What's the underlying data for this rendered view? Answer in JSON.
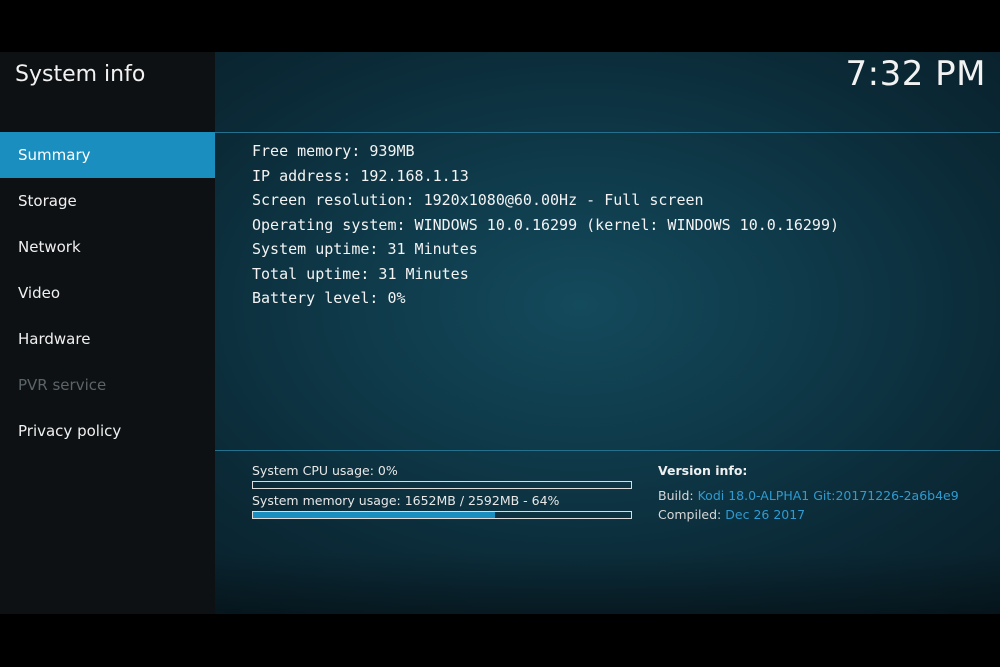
{
  "app": {
    "title": "System info",
    "clock": "7:32 PM"
  },
  "menu": {
    "items": [
      {
        "label": "Summary",
        "state": "active"
      },
      {
        "label": "Storage",
        "state": "normal"
      },
      {
        "label": "Network",
        "state": "normal"
      },
      {
        "label": "Video",
        "state": "normal"
      },
      {
        "label": "Hardware",
        "state": "normal"
      },
      {
        "label": "PVR service",
        "state": "disabled"
      },
      {
        "label": "Privacy policy",
        "state": "normal"
      }
    ]
  },
  "summary": {
    "lines": [
      "Free memory: 939MB",
      "IP address: 192.168.1.13",
      "Screen resolution: 1920x1080@60.00Hz - Full screen",
      "Operating system: WINDOWS 10.0.16299 (kernel: WINDOWS 10.0.16299)",
      "System uptime: 31 Minutes",
      "Total uptime: 31 Minutes",
      "Battery level: 0%"
    ]
  },
  "usage": {
    "cpu_label": "System CPU usage: 0%",
    "cpu_percent": 0,
    "memory_label": "System memory usage: 1652MB / 2592MB - 64%",
    "memory_percent": 64
  },
  "version": {
    "title": "Version info:",
    "build_label": "Build:",
    "build_value": "Kodi 18.0-ALPHA1 Git:20171226-2a6b4e9",
    "compiled_label": "Compiled:",
    "compiled_value": "Dec 26 2017"
  },
  "colors": {
    "accent": "#1a8fbf",
    "link": "#2f9bd0",
    "sidebar_bg": "#0d1114"
  }
}
